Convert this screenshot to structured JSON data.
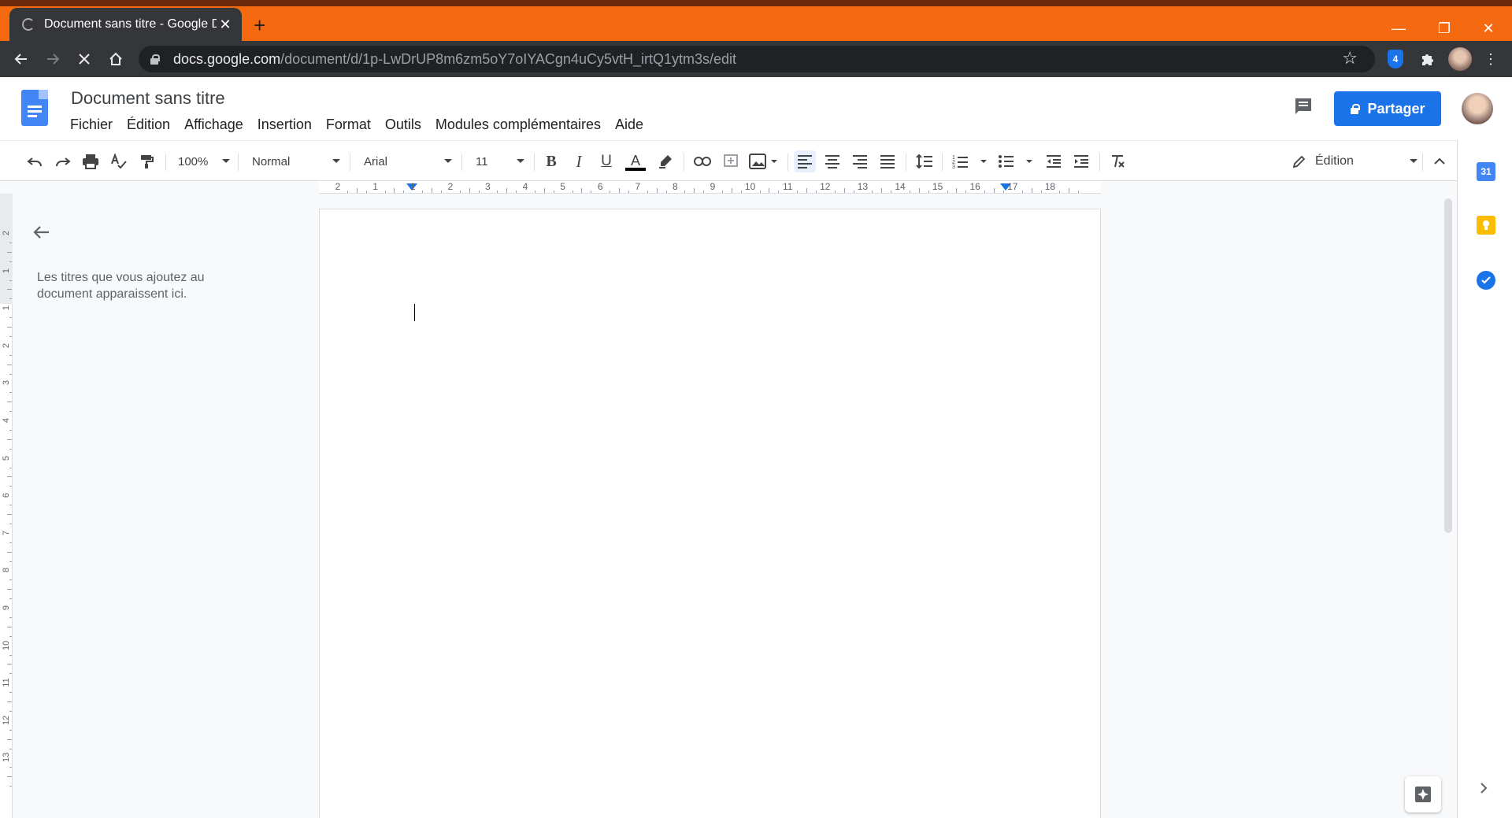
{
  "browser": {
    "tab_title": "Document sans titre - Google Dc",
    "tab_close": "✕",
    "new_tab": "+",
    "url_host": "docs.google.com",
    "url_path": "/document/d/1p-LwDrUP8m6zm5oY7oIYACgn4uCy5vtH_irtQ1ytm3s/edit",
    "ext_badge": "4",
    "win_min": "—",
    "win_restore": "❐",
    "win_close": "✕"
  },
  "docs": {
    "title": "Document sans titre",
    "menu": [
      "Fichier",
      "Édition",
      "Affichage",
      "Insertion",
      "Format",
      "Outils",
      "Modules complémentaires",
      "Aide"
    ],
    "share_label": "Partager"
  },
  "toolbar": {
    "zoom": "100%",
    "style": "Normal",
    "font": "Arial",
    "size": "11",
    "mode": "Édition",
    "bold": "B",
    "italic": "I",
    "underline": "U",
    "textcolor": "A"
  },
  "ruler": {
    "labels": [
      "2",
      "1",
      "1",
      "2",
      "3",
      "4",
      "5",
      "6",
      "7",
      "8",
      "9",
      "10",
      "11",
      "12",
      "13",
      "14",
      "15",
      "16",
      "17",
      "18"
    ],
    "vlabels": [
      "2",
      "1",
      "1",
      "2",
      "3",
      "4",
      "5",
      "6",
      "7",
      "8",
      "9",
      "10",
      "11",
      "12",
      "13"
    ]
  },
  "outline": {
    "empty_text": "Les titres que vous ajoutez au document apparaissent ici."
  },
  "side_panel": {
    "calendar_label": "31"
  },
  "colors": {
    "accent": "#1a73e8",
    "tabbar": "#f56a10"
  }
}
